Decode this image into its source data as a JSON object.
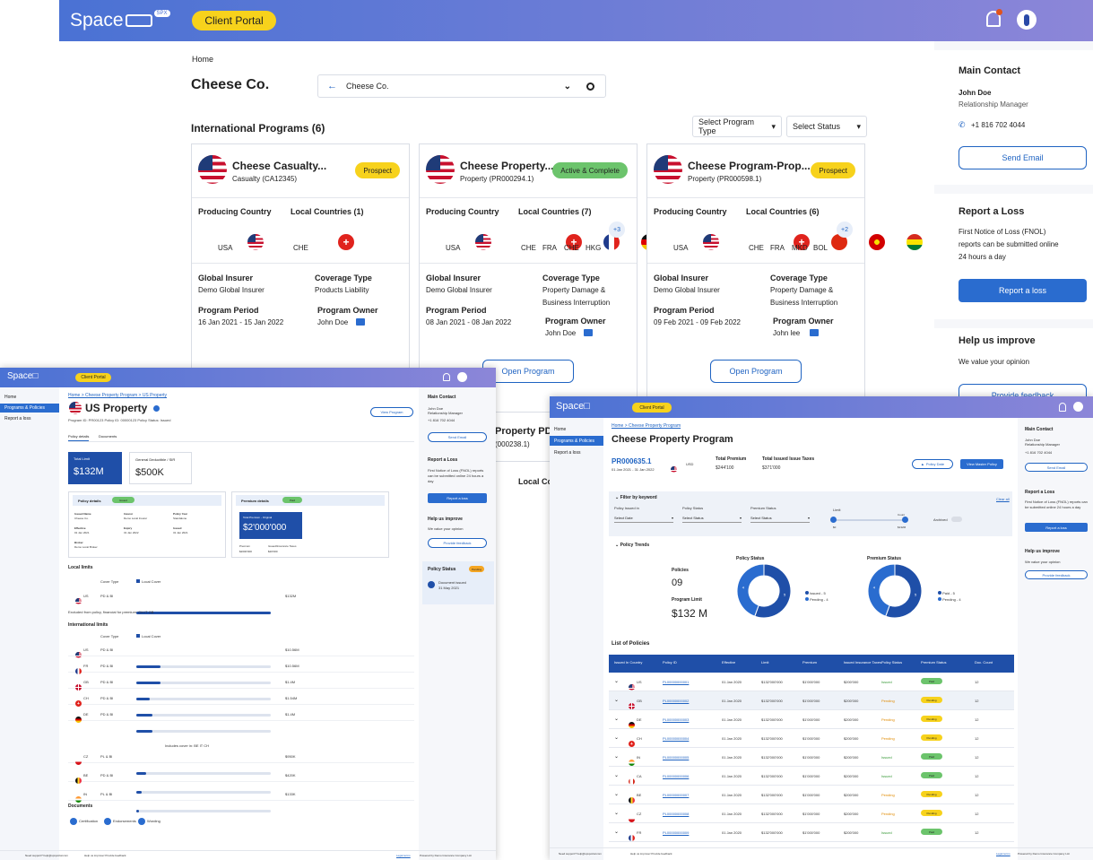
{
  "main": {
    "logo": "Space",
    "logo_badge": "SPX",
    "portal": "Client Portal",
    "breadcrumb": "Home",
    "company": "Cheese Co.",
    "company_select": "Cheese Co.",
    "programs_title": "International Programs (6)",
    "filter_type": "Select Program Type",
    "filter_status": "Select Status",
    "cards": [
      {
        "title": "Cheese Casualty...",
        "sub": "Casualty (CA12345)",
        "status": "Prospect",
        "status_color": "#f7d21c",
        "local_title": "Local Countries (1)",
        "producing": "USA",
        "locals": [
          {
            "code": "CHE",
            "cls": "ch"
          }
        ],
        "more": "",
        "insurer": "Demo Global Insurer",
        "coverage": "Products Liability",
        "coverage2": "",
        "period": "16 Jan 2021 - 15 Jan 2022",
        "owner": "John Doe"
      },
      {
        "title": "Cheese Property...",
        "sub": "Property (PR000294.1)",
        "status": "Active & Complete",
        "status_color": "#6cc46c",
        "local_title": "Local Countries (7)",
        "producing": "USA",
        "locals": [
          {
            "code": "CHE",
            "cls": "ch"
          },
          {
            "code": "FRA",
            "cls": "fr"
          },
          {
            "code": "CHE",
            "cls": "de"
          },
          {
            "code": "HKG",
            "cls": "hk"
          }
        ],
        "more": "+3",
        "insurer": "Demo Global Insurer",
        "coverage": "Property Damage &",
        "coverage2": "Business Interruption",
        "period": "08 Jan 2021 - 08 Jan 2022",
        "owner": "John Doe"
      },
      {
        "title": "Cheese Program-Prop...",
        "sub": "Property (PR000598.1)",
        "status": "Prospect",
        "status_color": "#f7d21c",
        "local_title": "Local Countries (6)",
        "producing": "USA",
        "locals": [
          {
            "code": "CHE",
            "cls": "ch"
          },
          {
            "code": "FRA",
            "cls": "hk"
          },
          {
            "code": "MKD",
            "cls": "mk"
          },
          {
            "code": "BOL",
            "cls": "bo"
          }
        ],
        "more": "+2",
        "insurer": "Demo Global Insurer",
        "coverage": "Property Damage &",
        "coverage2": "Business Interruption",
        "period": "09 Feb 2021 - 09 Feb 2022",
        "owner": "John lee"
      }
    ],
    "labels": {
      "producing": "Producing Country",
      "insurer": "Global Insurer",
      "coverage": "Coverage Type",
      "period": "Program Period",
      "owner": "Program Owner",
      "open": "Open Program"
    },
    "contact": {
      "title": "Main Contact",
      "name": "John Doe",
      "role": "Relationship Manager",
      "phone": "+1 816 702 4044",
      "email_btn": "Send Email"
    },
    "loss": {
      "title": "Report a Loss",
      "text1": "First Notice of Loss (FNOL)",
      "text2": "reports can be submitted online",
      "text3": "24 hours a day",
      "btn": "Report a loss"
    },
    "improve": {
      "title": "Help us improve",
      "text": "We value your opinion",
      "btn": "Provide feedback"
    },
    "partial": {
      "title": "Property PD.",
      "sub": "(000238.1)",
      "local": "Local Co"
    }
  },
  "left": {
    "portal": "Client Portal",
    "nav": [
      "Home",
      "Programs & Policies",
      "Report a loss"
    ],
    "breadcrumb": "Home > Cheese Property Program > US Property",
    "title": "US Property",
    "meta": "Program ID: PR00123   Policy ID: 00000123   Policy Status: Issued",
    "tabs": [
      "Policy details",
      "Documents"
    ],
    "view_btn": "View Program",
    "total_limit_label": "Total Limit",
    "total_limit": "$132M",
    "deductible_label": "General Deductible / SIR",
    "deductible": "$500K",
    "policy_details": "Policy details",
    "issued": "Issued",
    "premium_details": "Premium details",
    "premium_paid": "Paid",
    "pd_fields": [
      [
        "Issued Name",
        "Cheese Co."
      ],
      [
        "Insurer",
        "Demo Local Insurer"
      ],
      [
        "Policy Year",
        "Standalone"
      ],
      [
        "Effective",
        "01 Jan 2021"
      ],
      [
        "Expiry",
        "31 Jan 2022"
      ],
      [
        "Issued",
        "31 Jan 2021"
      ],
      [
        "Broker",
        "Demo Local Broker"
      ]
    ],
    "premium_label": "Total Premium - Original",
    "premium_value": "$2'000'000",
    "prem_row": [
      "Premium",
      "Issued/Insurance Taxes",
      "$2000'000",
      "$20'000"
    ],
    "local_limits": "Local limits",
    "int_limits": "International limits",
    "cover_type": "Cover Type",
    "local_cover": "Local Cover",
    "local_row": {
      "c": "US",
      "t": "PD & BI",
      "v": "$132M",
      "f": 1.0
    },
    "excluded": "Excluded from policy, financial for premium:  CH   IT   GB",
    "int_rows": [
      {
        "c": "US",
        "cls": "us",
        "t": "PD & BI",
        "v": "$10.56M",
        "f": 0.18
      },
      {
        "c": "FR",
        "cls": "fr",
        "t": "PD & BI",
        "v": "$10.56M",
        "f": 0.18
      },
      {
        "c": "GB",
        "cls": "gb",
        "t": "PD & BI",
        "v": "$1.4M",
        "f": 0.1
      },
      {
        "c": "CH",
        "cls": "ch",
        "t": "PD & BI",
        "v": "$1.54M",
        "f": 0.12
      },
      {
        "c": "DE",
        "cls": "de",
        "t": "PD & BI",
        "v": "$1.4M",
        "f": 0.12
      },
      {
        "c": "CZ",
        "cls": "cz",
        "t": "PL & BI",
        "v": "$950K",
        "f": 0.07
      },
      {
        "c": "BE",
        "cls": "be",
        "t": "PD & BI",
        "v": "$420K",
        "f": 0.04
      },
      {
        "c": "IN",
        "cls": "in",
        "t": "PL & BI",
        "v": "$133K",
        "f": 0.02
      }
    ],
    "included": "Includes cover in:  BE   IT   CH",
    "documents": "Documents",
    "docs": [
      "Certification",
      "Endorsements",
      "Wording"
    ],
    "contact": {
      "title": "Main Contact",
      "name": "John Doe",
      "role": "Relationship Manager",
      "phone": "+1 816 702 4044",
      "btn": "Send Email"
    },
    "loss": {
      "title": "Report a Loss",
      "text": "First Notice of Loss (FNOL) reports can be submitted online 24 hours a day",
      "btn": "Report a loss"
    },
    "improve": {
      "title": "Help us improve",
      "text": "We value your opinion",
      "btn": "Provide feedback"
    },
    "status": {
      "title": "Policy Status",
      "badge": "Pending",
      "item": "Document issued",
      "date": "31 May 2021"
    },
    "footer_left": "Need support? help@spxportal.com",
    "footer_mid": "Help us improve! Provide feedback",
    "footer_r1": "Legal terms",
    "footer_r2": "Powered by Demo Insurance Company Ltd."
  },
  "right": {
    "portal": "Client Portal",
    "nav": [
      "Home",
      "Programs & Policies",
      "Report a loss"
    ],
    "breadcrumb": "Home > Cheese Property Program",
    "title": "Cheese Property Program",
    "program_id": "PR000635.1",
    "program_dates": "01 Jan 2021 - 31 Jan 2022",
    "currency": "USD",
    "total_premium_label": "Total Premium",
    "total_premium": "$244'100",
    "taxes_label": "Total Issued Issue Taxes",
    "taxes": "$371'000",
    "btn_edit": "Policy Date",
    "btn_add": "View Master Policy",
    "filter_title": "Filter by keyword",
    "clear": "Clear all",
    "filters": [
      [
        "Policy Issued in",
        "Select Date"
      ],
      [
        "Policy Status",
        "Select Status"
      ],
      [
        "Premium Status",
        "Select Status"
      ]
    ],
    "limit_label": "Limit",
    "limit_min": "$0",
    "limit_max": "$132M",
    "limit_count": "Count",
    "archived": "Archived",
    "trends": "Policy Trends",
    "policy_status": "Policy Status",
    "premium_status": "Premium Status",
    "policies_label": "Policies",
    "policies": "09",
    "program_limit_label": "Program Limit",
    "program_limit": "$132 M",
    "donut1": {
      "values": [
        5,
        4
      ],
      "legend": [
        "Issued - 5",
        "Pending - 4"
      ]
    },
    "donut2": {
      "values": [
        5,
        4
      ],
      "legend": [
        "Paid - 5",
        "Pending - 4"
      ]
    },
    "list_title": "List of Policies",
    "columns": [
      "Issued In Country",
      "Policy ID",
      "Effective",
      "Limit",
      "Premium",
      "Issued Insurance Taxes",
      "Policy Status",
      "Premium Status",
      "Doc. Count"
    ],
    "rows": [
      {
        "c": "US",
        "cls": "us",
        "id": "PL00000000001",
        "eff": "01 Jan 2020",
        "lim": "$132'000'000",
        "prem": "$1'000'000",
        "tax": "$200'000",
        "ps": "Issued",
        "pm": "Paid",
        "dc": "12"
      },
      {
        "c": "GB",
        "cls": "gb",
        "id": "PL00000000002",
        "eff": "01 Jan 2020",
        "lim": "$132'000'000",
        "prem": "$1'000'000",
        "tax": "$200'000",
        "ps": "Pending",
        "pm": "Pending",
        "dc": "12"
      },
      {
        "c": "DE",
        "cls": "de",
        "id": "PL00000000003",
        "eff": "01 Jan 2020",
        "lim": "$132'000'000",
        "prem": "$1'000'000",
        "tax": "$200'000",
        "ps": "Pending",
        "pm": "Pending",
        "dc": "12"
      },
      {
        "c": "CH",
        "cls": "ch",
        "id": "PL00000000004",
        "eff": "01 Jan 2020",
        "lim": "$132'000'000",
        "prem": "$1'000'000",
        "tax": "$200'000",
        "ps": "Pending",
        "pm": "Pending",
        "dc": "12"
      },
      {
        "c": "IN",
        "cls": "in",
        "id": "PL00000000005",
        "eff": "01 Jan 2020",
        "lim": "$132'000'000",
        "prem": "$1'000'000",
        "tax": "$200'000",
        "ps": "Issued",
        "pm": "Paid",
        "dc": "12"
      },
      {
        "c": "CA",
        "cls": "ca",
        "id": "PL00000000006",
        "eff": "01 Jan 2020",
        "lim": "$132'000'000",
        "prem": "$1'000'000",
        "tax": "$200'000",
        "ps": "Issued",
        "pm": "Paid",
        "dc": "12"
      },
      {
        "c": "BE",
        "cls": "be",
        "id": "PL00000000007",
        "eff": "01 Jan 2020",
        "lim": "$132'000'000",
        "prem": "$1'000'000",
        "tax": "$200'000",
        "ps": "Pending",
        "pm": "Pending",
        "dc": "12"
      },
      {
        "c": "CZ",
        "cls": "cz",
        "id": "PL00000000008",
        "eff": "01 Jan 2020",
        "lim": "$132'000'000",
        "prem": "$1'000'000",
        "tax": "$200'000",
        "ps": "Pending",
        "pm": "Pending",
        "dc": "12"
      },
      {
        "c": "FR",
        "cls": "fr",
        "id": "PL00000000009",
        "eff": "01 Jan 2020",
        "lim": "$132'000'000",
        "prem": "$1'000'000",
        "tax": "$200'000",
        "ps": "Issued",
        "pm": "Paid",
        "dc": "12"
      }
    ],
    "contact": {
      "title": "Main Contact",
      "name": "John Doe",
      "role": "Relationship Manager",
      "phone": "+1 816 702 4044",
      "btn": "Send Email"
    },
    "loss": {
      "title": "Report a Loss",
      "text": "First Notice of Loss (FNOL) reports can be submitted online 24 hours a day",
      "btn": "Report a loss"
    },
    "improve": {
      "title": "Help us improve",
      "text": "We value your opinion",
      "btn": "Provide feedback"
    },
    "footer_left": "Need support? help@spxportal.com",
    "footer_mid": "Help us improve! Provide feedback",
    "footer_r1": "Legal terms",
    "footer_r2": "Powered by Demo Insurance Company Ltd."
  },
  "colors": {
    "header_start": "#3f66cc",
    "header_end": "#8b86d9",
    "accent": "#1f63c2",
    "yellow": "#f7d21c",
    "green": "#6cc46c",
    "orange": "#f5a623",
    "navy": "#1f4fa8"
  }
}
